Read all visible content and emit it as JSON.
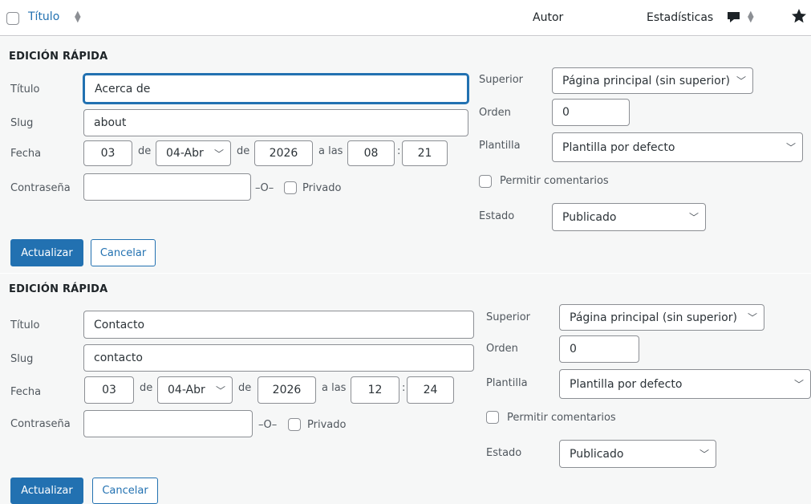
{
  "header": {
    "title_col": "Título",
    "author_col": "Autor",
    "stats_col": "Estadísticas"
  },
  "panels": [
    {
      "section_title": "EDICIÓN RÁPIDA",
      "labels": {
        "title": "Título",
        "slug": "Slug",
        "date": "Fecha",
        "password": "Contraseña",
        "parent": "Superior",
        "order": "Orden",
        "template": "Plantilla",
        "status": "Estado"
      },
      "title_value": "Acerca de",
      "slug_value": "about",
      "day": "03",
      "month": "04-Abr",
      "year": "2026",
      "hour": "08",
      "minute": "21",
      "de": "de",
      "a_las": "a las",
      "colon": ":",
      "password_value": "",
      "or_text": "–O–",
      "private_label": "Privado",
      "parent_value": "Página principal (sin superior)",
      "order_value": "0",
      "template_value": "Plantilla por defecto",
      "comments_label": "Permitir comentarios",
      "status_value": "Publicado",
      "update_label": "Actualizar",
      "cancel_label": "Cancelar"
    },
    {
      "section_title": "EDICIÓN RÁPIDA",
      "labels": {
        "title": "Título",
        "slug": "Slug",
        "date": "Fecha",
        "password": "Contraseña",
        "parent": "Superior",
        "order": "Orden",
        "template": "Plantilla",
        "status": "Estado"
      },
      "title_value": "Contacto",
      "slug_value": "contacto",
      "day": "03",
      "month": "04-Abr",
      "year": "2026",
      "hour": "12",
      "minute": "24",
      "de": "de",
      "a_las": "a las",
      "colon": ":",
      "password_value": "",
      "or_text": "–O–",
      "private_label": "Privado",
      "parent_value": "Página principal (sin superior)",
      "order_value": "0",
      "template_value": "Plantilla por defecto",
      "comments_label": "Permitir comentarios",
      "status_value": "Publicado",
      "update_label": "Actualizar",
      "cancel_label": "Cancelar"
    }
  ]
}
